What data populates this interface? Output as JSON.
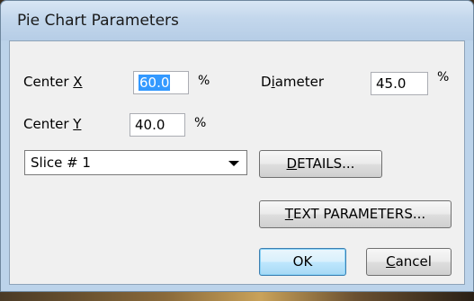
{
  "window": {
    "title": "Pie Chart Parameters"
  },
  "center_x": {
    "prefix": "Center ",
    "mnemonic": "X",
    "value": "60.0",
    "unit": "%"
  },
  "center_y": {
    "prefix": "Center ",
    "mnemonic": "Y",
    "value": "40.0",
    "unit": "%"
  },
  "diameter": {
    "prefix": "D",
    "mnemonic": "i",
    "suffix": "ameter",
    "value": "45.0",
    "unit": "%"
  },
  "slice_select": {
    "value": "Slice # 1"
  },
  "buttons": {
    "details": {
      "mnemonic": "D",
      "rest": "ETAILS..."
    },
    "text_parameters": {
      "mnemonic": "T",
      "rest": "EXT PARAMETERS..."
    },
    "ok": {
      "label": "OK"
    },
    "cancel": {
      "mnemonic": "C",
      "rest": "ancel"
    }
  },
  "colors": {
    "selection": "#3399ff",
    "titlebar": "#c3d7ec",
    "default_button_border": "#3c7fb1"
  }
}
